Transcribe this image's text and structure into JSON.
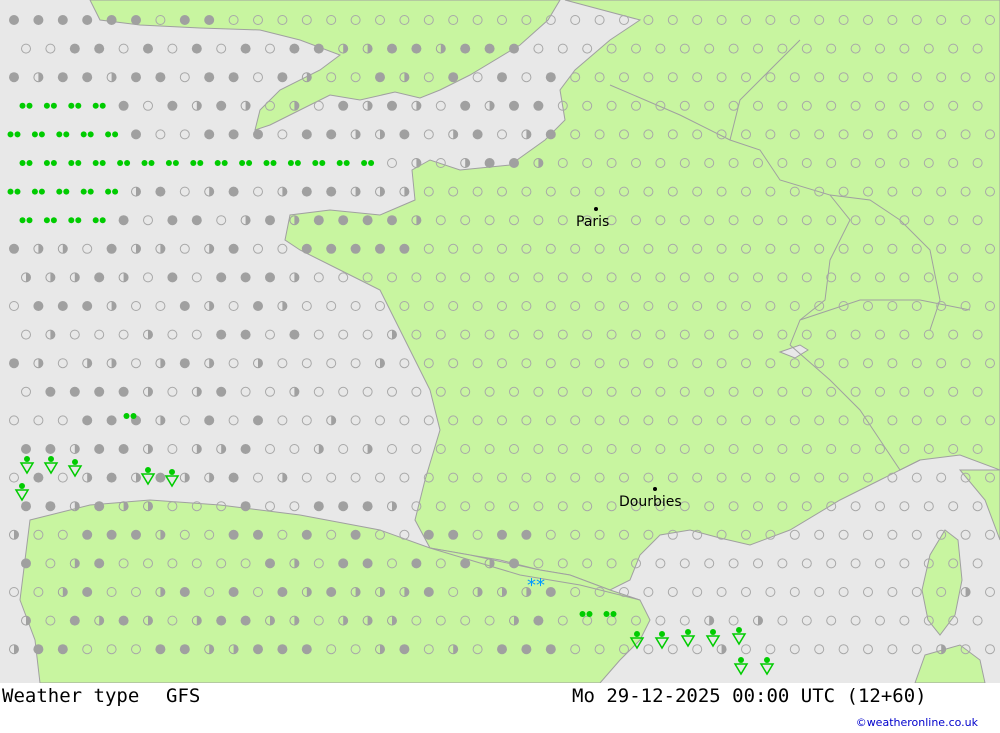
{
  "footer": {
    "product": "Weather type",
    "model": "GFS",
    "valid_time": "Mo 29-12-2025 00:00 UTC (12+60)",
    "credit": "©weatheronline.co.uk"
  },
  "map": {
    "cities": [
      {
        "name": "Paris"
      },
      {
        "name": "Dourbies"
      }
    ],
    "colors": {
      "sea": "#e8e8e8",
      "land": "#c8f5a0",
      "border": "#a0a0a0",
      "clear_symbol": "#a8a8a8",
      "cloud_symbol": "#a0a0a0",
      "drizzle_symbol": "#00cc00",
      "snow_symbol": "#0099ff"
    },
    "legend_symbols": [
      "clear-sky",
      "partly-cloudy",
      "overcast",
      "drizzle",
      "showers",
      "snow"
    ]
  }
}
